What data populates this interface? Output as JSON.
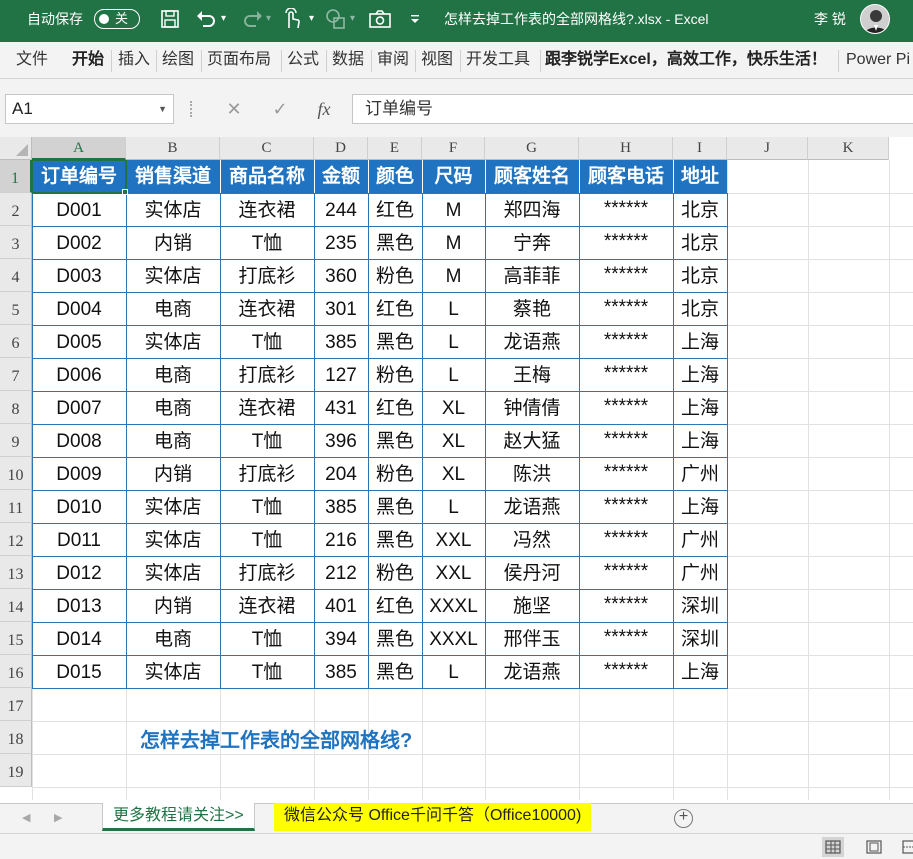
{
  "titlebar": {
    "autosave_label": "自动保存",
    "autosave_state": "关",
    "dropdown_glyph": "▾",
    "doc_title": "怎样去掉工作表的全部网格线?.xlsx  -  Excel",
    "user_name": "李 锐"
  },
  "ribbon": {
    "tabs": [
      "文件",
      "开始",
      "插入",
      "绘图",
      "页面布局",
      "公式",
      "数据",
      "审阅",
      "视图",
      "开发工具",
      "跟李锐学Excel，高效工作，快乐生活！",
      "Power Pi"
    ]
  },
  "formula_bar": {
    "name_box": "A1",
    "dropdown": "▼",
    "cancel": "✕",
    "enter": "✓",
    "fx": "fx",
    "content": "订单编号"
  },
  "sheet": {
    "columns": [
      "A",
      "B",
      "C",
      "D",
      "E",
      "F",
      "G",
      "H",
      "I",
      "J",
      "K"
    ],
    "rows": [
      "1",
      "2",
      "3",
      "4",
      "5",
      "6",
      "7",
      "8",
      "9",
      "10",
      "11",
      "12",
      "13",
      "14",
      "15",
      "16",
      "17",
      "18",
      "19"
    ],
    "headers": [
      "订单编号",
      "销售渠道",
      "商品名称",
      "金额",
      "颜色",
      "尺码",
      "顾客姓名",
      "顾客电话",
      "地址"
    ],
    "data": [
      [
        "D001",
        "实体店",
        "连衣裙",
        "244",
        "红色",
        "M",
        "郑四海",
        "******",
        "北京"
      ],
      [
        "D002",
        "内销",
        "T恤",
        "235",
        "黑色",
        "M",
        "宁奔",
        "******",
        "北京"
      ],
      [
        "D003",
        "实体店",
        "打底衫",
        "360",
        "粉色",
        "M",
        "高菲菲",
        "******",
        "北京"
      ],
      [
        "D004",
        "电商",
        "连衣裙",
        "301",
        "红色",
        "L",
        "蔡艳",
        "******",
        "北京"
      ],
      [
        "D005",
        "实体店",
        "T恤",
        "385",
        "黑色",
        "L",
        "龙语燕",
        "******",
        "上海"
      ],
      [
        "D006",
        "电商",
        "打底衫",
        "127",
        "粉色",
        "L",
        "王梅",
        "******",
        "上海"
      ],
      [
        "D007",
        "电商",
        "连衣裙",
        "431",
        "红色",
        "XL",
        "钟倩倩",
        "******",
        "上海"
      ],
      [
        "D008",
        "电商",
        "T恤",
        "396",
        "黑色",
        "XL",
        "赵大猛",
        "******",
        "上海"
      ],
      [
        "D009",
        "内销",
        "打底衫",
        "204",
        "粉色",
        "XL",
        "陈洪",
        "******",
        "广州"
      ],
      [
        "D010",
        "实体店",
        "T恤",
        "385",
        "黑色",
        "L",
        "龙语燕",
        "******",
        "上海"
      ],
      [
        "D011",
        "实体店",
        "T恤",
        "216",
        "黑色",
        "XXL",
        "冯然",
        "******",
        "广州"
      ],
      [
        "D012",
        "实体店",
        "打底衫",
        "212",
        "粉色",
        "XXL",
        "侯丹河",
        "******",
        "广州"
      ],
      [
        "D013",
        "内销",
        "连衣裙",
        "401",
        "红色",
        "XXXL",
        "施坚",
        "******",
        "深圳"
      ],
      [
        "D014",
        "电商",
        "T恤",
        "394",
        "黑色",
        "XXXL",
        "邢伴玉",
        "******",
        "深圳"
      ],
      [
        "D015",
        "实体店",
        "T恤",
        "385",
        "黑色",
        "L",
        "龙语燕",
        "******",
        "上海"
      ]
    ],
    "caption": "怎样去掉工作表的全部网格线?"
  },
  "sheet_tabs": {
    "nav_prev": "◀",
    "nav_next": "▶",
    "tabs": [
      "更多教程请关注>>",
      "微信公众号 Office千问千答（Office10000)"
    ],
    "add": "+"
  },
  "colors": {
    "excel_green": "#217346",
    "header_fill": "#1f73c1",
    "table_border": "#2e75b6",
    "caption": "#1f73c1",
    "tab_highlight": "#ffff00"
  },
  "icons": [
    "save-icon",
    "undo-icon",
    "redo-icon",
    "touch-mode-icon",
    "shapes-icon",
    "camera-icon",
    "customize-qat-icon",
    "user-avatar",
    "normal-view-icon",
    "page-layout-view-icon",
    "page-break-view-icon"
  ]
}
